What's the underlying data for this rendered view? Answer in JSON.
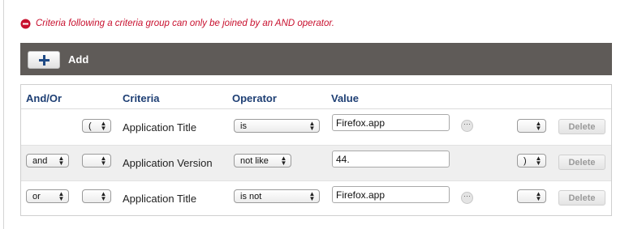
{
  "error": {
    "message": "Criteria following a criteria group can only be joined by an AND operator.",
    "icon": "error-icon",
    "color": "#c8102e"
  },
  "toolbar": {
    "add_label": "Add",
    "add_icon": "plus-icon"
  },
  "columns": {
    "and_or": "And/Or",
    "criteria": "Criteria",
    "operator": "Operator",
    "value": "Value"
  },
  "rows": [
    {
      "and_or": "",
      "open_paren": "(",
      "criteria": "Application Title",
      "operator": "is",
      "value": "Firefox.app",
      "close_paren": "",
      "delete_label": "Delete",
      "has_browse": true
    },
    {
      "and_or": "and",
      "open_paren": "",
      "criteria": "Application Version",
      "operator": "not like",
      "value": "44.",
      "close_paren": ")",
      "delete_label": "Delete",
      "has_browse": false
    },
    {
      "and_or": "or",
      "open_paren": "",
      "criteria": "Application Title",
      "operator": "is not",
      "value": "Firefox.app",
      "close_paren": "",
      "delete_label": "Delete",
      "has_browse": true
    }
  ]
}
